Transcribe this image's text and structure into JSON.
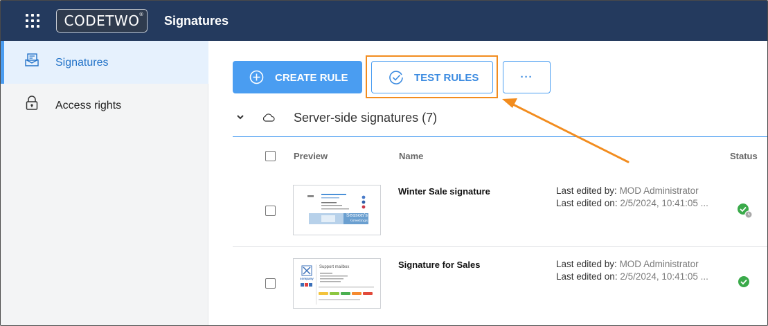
{
  "header": {
    "logo_text": "CODETWO",
    "logo_mark": "®",
    "app_title": "Signatures"
  },
  "sidebar": {
    "items": [
      {
        "label": "Signatures",
        "icon": "signature-icon",
        "active": true
      },
      {
        "label": "Access rights",
        "icon": "lock-icon",
        "active": false
      }
    ]
  },
  "toolbar": {
    "create_label": "CREATE RULE",
    "test_label": "TEST RULES",
    "more_label": "···"
  },
  "section": {
    "title": "Server-side signatures (7)"
  },
  "table": {
    "columns": [
      "Preview",
      "Name",
      "Status"
    ],
    "rows": [
      {
        "name": "Winter Sale signature",
        "edited_by_label": "Last edited by: ",
        "edited_by": "MOD Administrator",
        "edited_on_label": "Last edited on: ",
        "edited_on": "2/5/2024, 10:41:05 ...",
        "status": "active-pending",
        "preview": {
          "banner_text": "Season's",
          "banner_sub": "Greetings"
        }
      },
      {
        "name": "Signature for Sales",
        "edited_by_label": "Last edited by: ",
        "edited_by": "MOD Administrator",
        "edited_on_label": "Last edited on: ",
        "edited_on": "2/5/2024, 10:41:05 ...",
        "status": "active",
        "preview": {
          "title": "Support mailbox",
          "company": "company"
        }
      }
    ]
  },
  "colors": {
    "topbar": "#243a5e",
    "accent": "#4a9df1",
    "highlight": "#f28c1e",
    "status_ok": "#3aaa4a"
  }
}
